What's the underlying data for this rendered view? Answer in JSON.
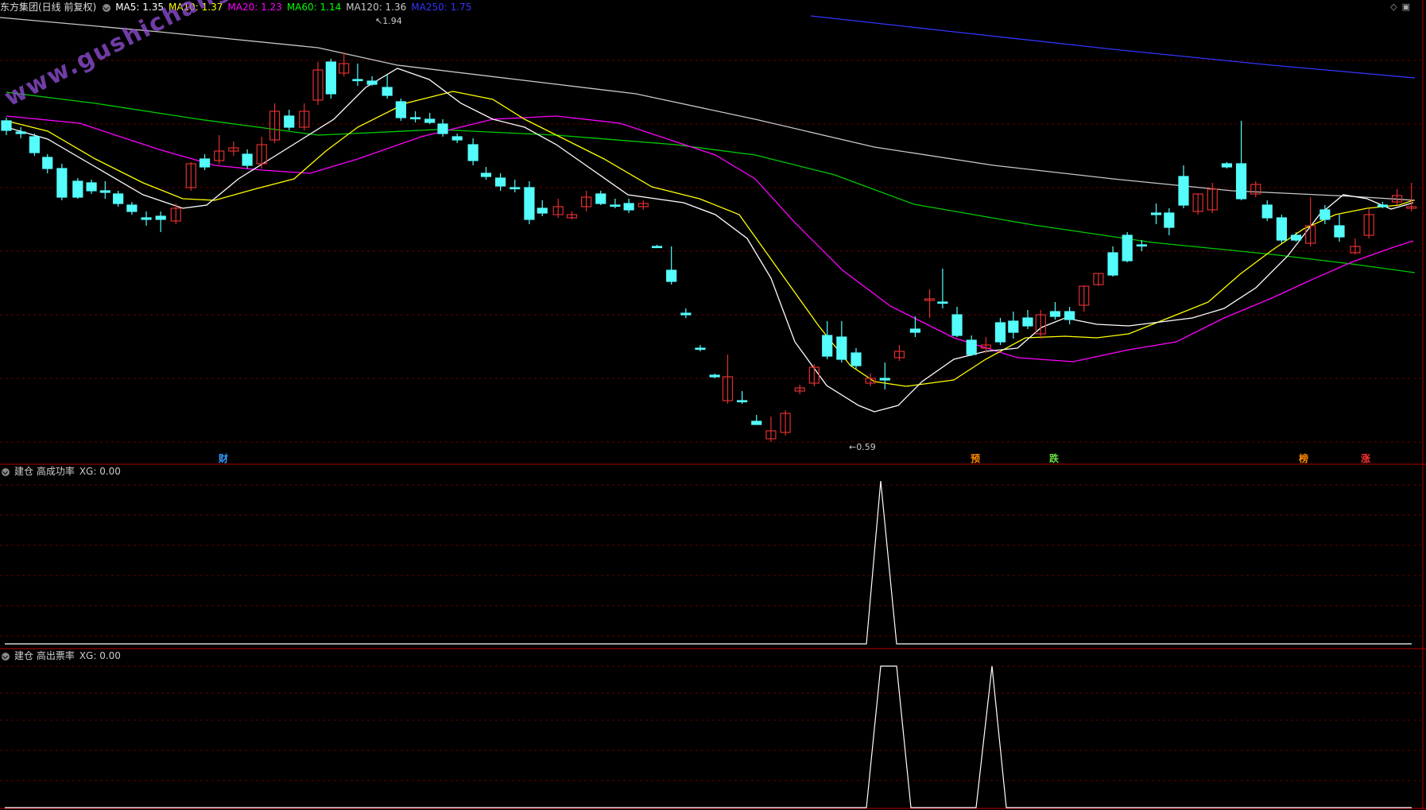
{
  "main_panel": {
    "title": "东方集团(日线 前复权)",
    "ma_labels": [
      {
        "text": "MA5: 1.35",
        "color": "#ffffff"
      },
      {
        "text": "MA10: 1.37",
        "color": "#ffff00"
      },
      {
        "text": "MA20: 1.23",
        "color": "#ff00ff"
      },
      {
        "text": "MA60: 1.14",
        "color": "#00ff00"
      },
      {
        "text": "MA120: 1.36",
        "color": "#c8c8c8"
      },
      {
        "text": "MA250: 1.75",
        "color": "#3333ff"
      }
    ],
    "high_label": "1.94",
    "low_label": "0.59",
    "watermark": "www.gushichanghong.com",
    "markers": [
      {
        "text": "财",
        "color": "#3399ff"
      },
      {
        "text": "预",
        "color": "#ff8800"
      },
      {
        "text": "跌",
        "color": "#66dd44"
      },
      {
        "text": "榜",
        "color": "#ff8800"
      },
      {
        "text": "涨",
        "color": "#ff3333"
      }
    ]
  },
  "indicator_1": {
    "title": "建仓 高成功率",
    "value": "XG: 0.00"
  },
  "indicator_2": {
    "title": "建仓 高出票率",
    "value": "XG: 0.00"
  },
  "icons": [
    "collapse-icon",
    "diamond-icon",
    "window-icon"
  ]
}
